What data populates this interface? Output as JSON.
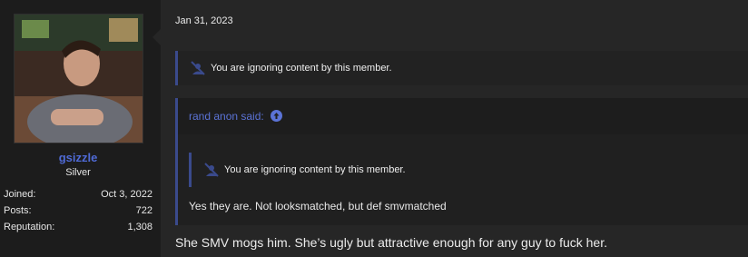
{
  "user": {
    "avatar_icon": "avatar-photo",
    "username": "gsizzle",
    "title": "Silver",
    "stats": [
      {
        "label": "Joined:",
        "value": "Oct 3, 2022"
      },
      {
        "label": "Posts:",
        "value": "722"
      },
      {
        "label": "Reputation:",
        "value": "1,308"
      }
    ]
  },
  "post": {
    "date": "Jan 31, 2023",
    "ignored_notice": "You are ignoring content by this member.",
    "quote": {
      "attribution": "rand anon said:",
      "ignored_notice": "You are ignoring content by this member.",
      "body": "Yes they are. Not looksmatched, but def smvmatched"
    },
    "reply": "She SMV mogs him. She’s ugly but attractive enough for any guy to fuck her."
  },
  "colors": {
    "accent": "#5b73d6",
    "quote_border": "#3a4a8c",
    "background": "#262626"
  }
}
